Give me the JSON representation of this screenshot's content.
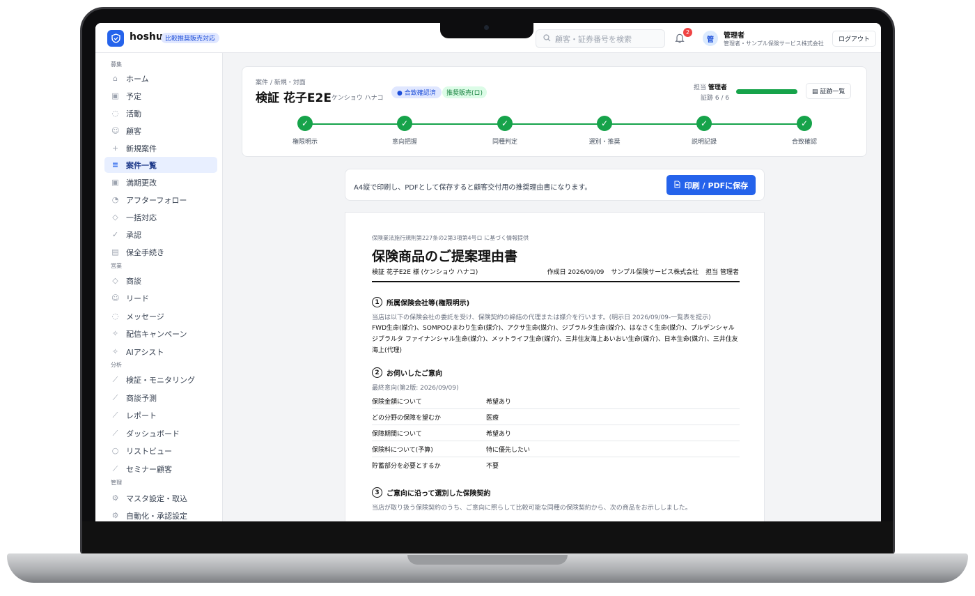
{
  "app": {
    "brand": "hoshu",
    "badge": "比較推奨販売対応"
  },
  "header": {
    "search_placeholder": "顧客・証券番号を検索",
    "notifications": "2",
    "avatar_initial": "管",
    "user_name": "管理者",
    "user_role": "管理者・サンプル保険サービス株式会社",
    "logout": "ログアウト"
  },
  "sidebar": {
    "sections": [
      "募集",
      "営業",
      "分析",
      "管理"
    ],
    "items": [
      {
        "label": "ホーム",
        "icon": "home-icon"
      },
      {
        "label": "予定",
        "icon": "calendar-icon"
      },
      {
        "label": "活動",
        "icon": "chat-icon"
      },
      {
        "label": "顧客",
        "icon": "users-icon"
      },
      {
        "label": "新規案件",
        "icon": "plus-icon"
      },
      {
        "label": "案件一覧",
        "icon": "list-icon"
      },
      {
        "label": "満期更改",
        "icon": "calendar-icon"
      },
      {
        "label": "アフターフォロー",
        "icon": "bell-icon"
      },
      {
        "label": "一括対応",
        "icon": "layers-icon"
      },
      {
        "label": "承認",
        "icon": "check-icon"
      },
      {
        "label": "保全手続き",
        "icon": "file-icon"
      },
      {
        "label": "商談",
        "icon": "layers-icon"
      },
      {
        "label": "リード",
        "icon": "users-icon"
      },
      {
        "label": "メッセージ",
        "icon": "chat-icon"
      },
      {
        "label": "配信キャンペーン",
        "icon": "sparkle-icon"
      },
      {
        "label": "AIアシスト",
        "icon": "sparkle-icon"
      },
      {
        "label": "検証・モニタリング",
        "icon": "chart-icon"
      },
      {
        "label": "商談予測",
        "icon": "chart-icon"
      },
      {
        "label": "レポート",
        "icon": "chart-icon"
      },
      {
        "label": "ダッシュボード",
        "icon": "chart-icon"
      },
      {
        "label": "リストビュー",
        "icon": "search-icon"
      },
      {
        "label": "セミナー顧客",
        "icon": "chart-icon"
      },
      {
        "label": "マスタ設定・取込",
        "icon": "gear-icon"
      },
      {
        "label": "自動化・承認設定",
        "icon": "gear-icon"
      }
    ]
  },
  "case": {
    "breadcrumb": "案件 / 新規・対面",
    "title": "検証 花子E2E",
    "kana": "ケンショウ ハナコ",
    "status_badge": "● 合致確認済",
    "sales_badge": "推奨販売(ロ)",
    "assignee_label": "担当",
    "assignee": "管理者",
    "evidence": "証跡 6 / 6",
    "evidence_progress": 1.0,
    "evidence_button": "証跡一覧",
    "steps": [
      "権限明示",
      "意向把握",
      "同種判定",
      "選別・推奨",
      "説明記録",
      "合致確認"
    ]
  },
  "print_bar": {
    "text": "A4縦で印刷し、PDFとして保存すると顧客交付用の推奨理由書になります。",
    "button": "印刷 / PDFに保存"
  },
  "document": {
    "law": "保険業法施行規則第227条の2第3項第4号ロ に基づく情報提供",
    "title": "保険商品のご提案理由書",
    "customer": "検証 花子E2E 様 (ケンショウ ハナコ)",
    "created": "作成日 2026/09/09",
    "company": "サンプル保険サービス株式会社",
    "staff": "担当 管理者",
    "s1_num": "1",
    "s1_title": "所属保険会社等(権限明示)",
    "s1_note": "当店は以下の保険会社の委託を受け、保険契約の締結の代理または媒介を行います。(明示日 2026/09/09-一覧表を提示)",
    "s1_body": "FWD生命(媒介)、SOMPOひまわり生命(媒介)、アクサ生命(媒介)、ジブラルタ生命(媒介)、はなさく生命(媒介)、プルデンシャル ジブラルタ ファイナンシャル生命(媒介)、メットライフ生命(媒介)、三井住友海上あいおい生命(媒介)、日本生命(媒介)、三井住友海上(代理)",
    "s2_num": "2",
    "s2_title": "お伺いしたご意向",
    "s2_note": "最終意向(第2版: 2026/09/09)",
    "s2_rows": [
      {
        "k": "保険金額について",
        "v": "希望あり"
      },
      {
        "k": "どの分野の保障を望むか",
        "v": "医療"
      },
      {
        "k": "保障期間について",
        "v": "希望あり"
      },
      {
        "k": "保険料について(予算)",
        "v": "特に優先したい"
      },
      {
        "k": "貯蓄部分を必要とするか",
        "v": "不要"
      }
    ],
    "s3_num": "3",
    "s3_title": "ご意向に沿って選別した保険契約",
    "s3_note": "当店が取り扱う保険契約のうち、ご意向に照らして比較可能な同種の保険契約から、次の商品をお示ししました。"
  },
  "colors": {
    "accent": "#2563eb",
    "success": "#16a34a",
    "active_nav_bg": "#e8efff"
  }
}
